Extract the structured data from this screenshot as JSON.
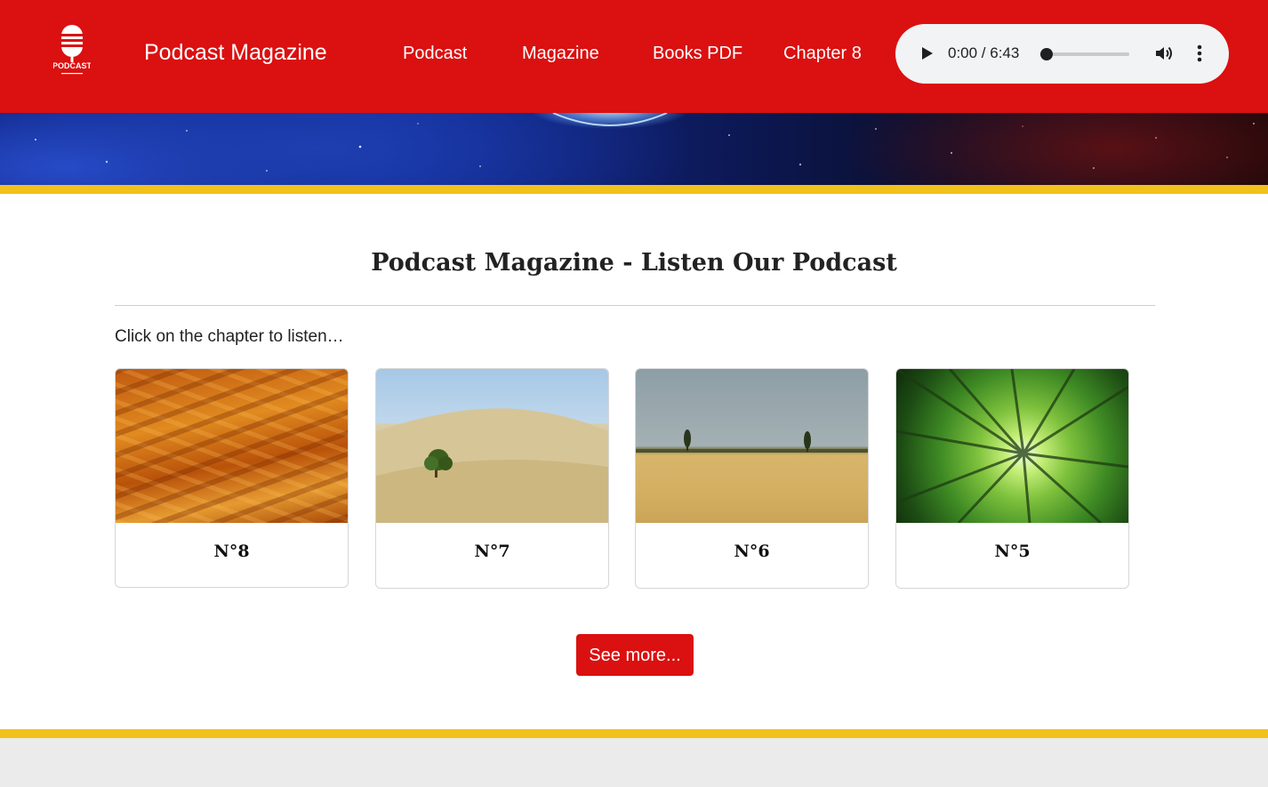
{
  "header": {
    "logo": {
      "icon": "microphone-icon",
      "text": "PODCAST"
    },
    "brand": "Podcast Magazine",
    "nav": [
      {
        "label": "Podcast"
      },
      {
        "label": "Magazine"
      },
      {
        "label": "Books PDF"
      },
      {
        "label": "Chapter 8"
      }
    ],
    "colors": {
      "primary": "#db1010",
      "accent": "#f1c21b"
    }
  },
  "player": {
    "time": "0:00 / 6:43",
    "progress": 0.0,
    "icons": {
      "play": "play-icon",
      "volume": "volume-icon",
      "menu": "more-vertical-icon"
    }
  },
  "main": {
    "title": "Podcast Magazine - Listen Our Podcast",
    "hint": "Click on the chapter to listen…",
    "cards": [
      {
        "label": "N°8"
      },
      {
        "label": "N°7"
      },
      {
        "label": "N°6"
      },
      {
        "label": "N°5"
      }
    ],
    "see_more": "See more..."
  }
}
